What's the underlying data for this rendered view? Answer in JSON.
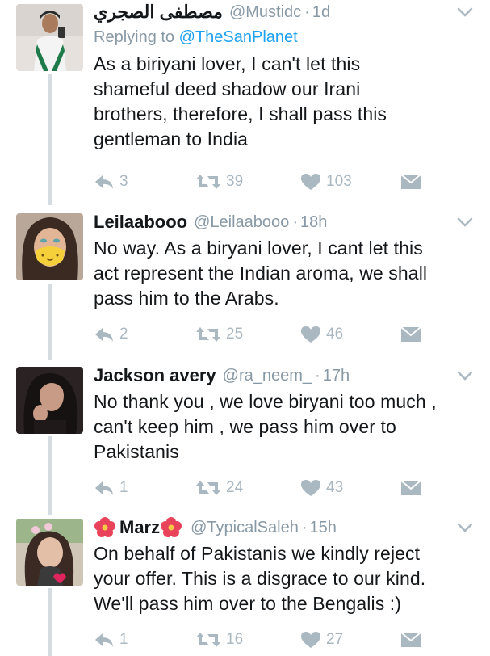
{
  "tweets": [
    {
      "name": "مصطفى الصجري",
      "handle": "@Mustidc",
      "time": "1d",
      "reply_prefix": "Replying to ",
      "reply_handle": "@TheSanPlanet",
      "lines": [
        "As a biriyani lover, I can't let this",
        "shameful deed shadow our Irani",
        "brothers, therefore, I shall pass this",
        "gentleman to India"
      ],
      "replies": "3",
      "retweets": "39",
      "likes": "103"
    },
    {
      "name": "Leilaabooo",
      "handle": "@Leilaabooo",
      "time": "18h",
      "lines": [
        "No way. As a biryani lover, I cant let this",
        "act represent the Indian aroma, we shall",
        "pass him to the Arabs."
      ],
      "replies": "2",
      "retweets": "25",
      "likes": "46"
    },
    {
      "name": "Jackson avery",
      "handle": "@ra_neem_",
      "time": "17h",
      "lines": [
        "No thank you , we love biryani too much ,",
        "can't keep him , we pass him over to",
        "Pakistanis"
      ],
      "replies": "1",
      "retweets": "24",
      "likes": "43"
    },
    {
      "name": "Marz",
      "handle": "@TypicalSaleh",
      "time": "15h",
      "lines": [
        "On behalf of Pakistanis we kindly reject",
        "your offer. This is a disgrace to our kind.",
        "We'll pass him over to the Bengalis :)"
      ],
      "replies": "1",
      "retweets": "16",
      "likes": "27"
    }
  ],
  "separator": "·",
  "icons": {
    "reply": "reply-icon",
    "retweet": "retweet-icon",
    "like": "heart-icon",
    "dm": "envelope-icon",
    "more": "chevron-down-icon",
    "flower": "hibiscus-emoji-icon"
  },
  "colors": {
    "text": "#14171a",
    "muted": "#8899a6",
    "link": "#1da1f2",
    "action": "#aab8c2",
    "thread_line": "#d5dde3"
  }
}
